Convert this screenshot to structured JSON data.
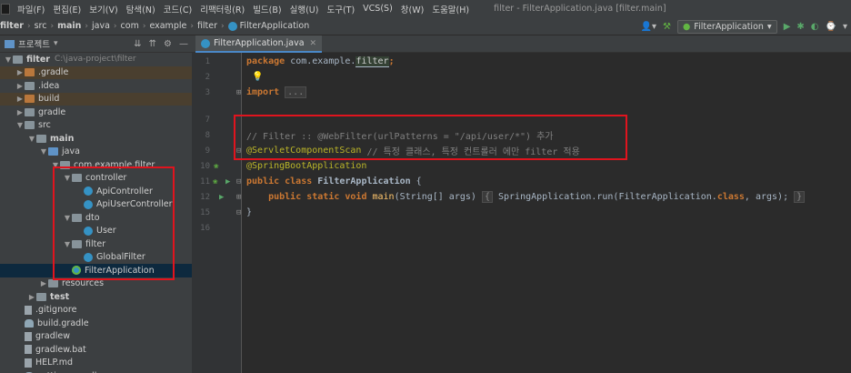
{
  "menubar": {
    "items": [
      "파일(F)",
      "편집(E)",
      "보기(V)",
      "탐색(N)",
      "코드(C)",
      "리팩터링(R)",
      "빌드(B)",
      "실행(U)",
      "도구(T)",
      "VCS(S)",
      "창(W)",
      "도움말(H)"
    ],
    "window_title": "filter - FilterApplication.java [filter.main]"
  },
  "breadcrumb": {
    "items": [
      "filter",
      "src",
      "main",
      "java",
      "com",
      "example",
      "filter",
      "FilterApplication"
    ]
  },
  "toolbar": {
    "run_config": "FilterApplication"
  },
  "project_panel": {
    "title": "프로젝트",
    "tree": [
      {
        "label": "filter",
        "hint": "C:\\java-project\\filter",
        "indent": 0,
        "icon": "folder",
        "arrow": "down",
        "bold": true
      },
      {
        "label": ".gradle",
        "indent": 1,
        "icon": "folder-orange",
        "arrow": "right",
        "excluded": true
      },
      {
        "label": ".idea",
        "indent": 1,
        "icon": "folder",
        "arrow": "right"
      },
      {
        "label": "build",
        "indent": 1,
        "icon": "folder-orange",
        "arrow": "right",
        "excluded": true
      },
      {
        "label": "gradle",
        "indent": 1,
        "icon": "folder",
        "arrow": "right"
      },
      {
        "label": "src",
        "indent": 1,
        "icon": "folder",
        "arrow": "down"
      },
      {
        "label": "main",
        "indent": 2,
        "icon": "folder",
        "arrow": "down",
        "bold": true
      },
      {
        "label": "java",
        "indent": 3,
        "icon": "folder-blue",
        "arrow": "down"
      },
      {
        "label": "com.example.filter",
        "indent": 4,
        "icon": "pkg",
        "arrow": "down"
      },
      {
        "label": "controller",
        "indent": 5,
        "icon": "pkg",
        "arrow": "down"
      },
      {
        "label": "ApiController",
        "indent": 6,
        "icon": "cls",
        "arrow": ""
      },
      {
        "label": "ApiUserController",
        "indent": 6,
        "icon": "cls",
        "arrow": ""
      },
      {
        "label": "dto",
        "indent": 5,
        "icon": "pkg",
        "arrow": "down"
      },
      {
        "label": "User",
        "indent": 6,
        "icon": "cls",
        "arrow": ""
      },
      {
        "label": "filter",
        "indent": 5,
        "icon": "pkg",
        "arrow": "down"
      },
      {
        "label": "GlobalFilter",
        "indent": 6,
        "icon": "cls",
        "arrow": ""
      },
      {
        "label": "FilterApplication",
        "indent": 5,
        "icon": "cls-boot",
        "arrow": "",
        "selected": true
      },
      {
        "label": "resources",
        "indent": 3,
        "icon": "folder",
        "arrow": "right"
      },
      {
        "label": "test",
        "indent": 2,
        "icon": "folder",
        "arrow": "right",
        "bold": true
      },
      {
        "label": ".gitignore",
        "indent": 1,
        "icon": "file",
        "arrow": ""
      },
      {
        "label": "build.gradle",
        "indent": 1,
        "icon": "gradle-file",
        "arrow": ""
      },
      {
        "label": "gradlew",
        "indent": 1,
        "icon": "file",
        "arrow": ""
      },
      {
        "label": "gradlew.bat",
        "indent": 1,
        "icon": "file",
        "arrow": ""
      },
      {
        "label": "HELP.md",
        "indent": 1,
        "icon": "file",
        "arrow": ""
      },
      {
        "label": "settings.gradle",
        "indent": 1,
        "icon": "gradle-file",
        "arrow": ""
      }
    ]
  },
  "editor": {
    "tab_label": "FilterApplication.java",
    "line_numbers": [
      "1",
      "2",
      "3",
      "7",
      "8",
      "9",
      "10",
      "11",
      "12",
      "15",
      "16"
    ],
    "code": {
      "line1_kw": "package",
      "line1_pkg": "com.example.",
      "line1_hl": "filter",
      "line1_end": ";",
      "line3_kw": "import",
      "line3_fold": "...",
      "line8_comment": "// Filter :: @WebFilter(urlPatterns = \"/api/user/*\") 추가",
      "line9_ann": "@ServletComponentScan",
      "line9_comment": " // 특정 클래스, 특정 컨트롤러 에만 filter 적용",
      "line10_ann": "@SpringBootApplication",
      "line11_kw": "public class",
      "line11_name": "FilterApplication",
      "line11_rest": " {",
      "line12_kw": "public static void",
      "line12_fn": "main",
      "line12_args": "(String[] args)",
      "line12_body_open": "{",
      "line12_body": " SpringApplication.run(FilterApplication.",
      "line12_class_kw": "class",
      "line12_body_end": ", args); ",
      "line12_body_close": "}",
      "line15": "}"
    }
  }
}
